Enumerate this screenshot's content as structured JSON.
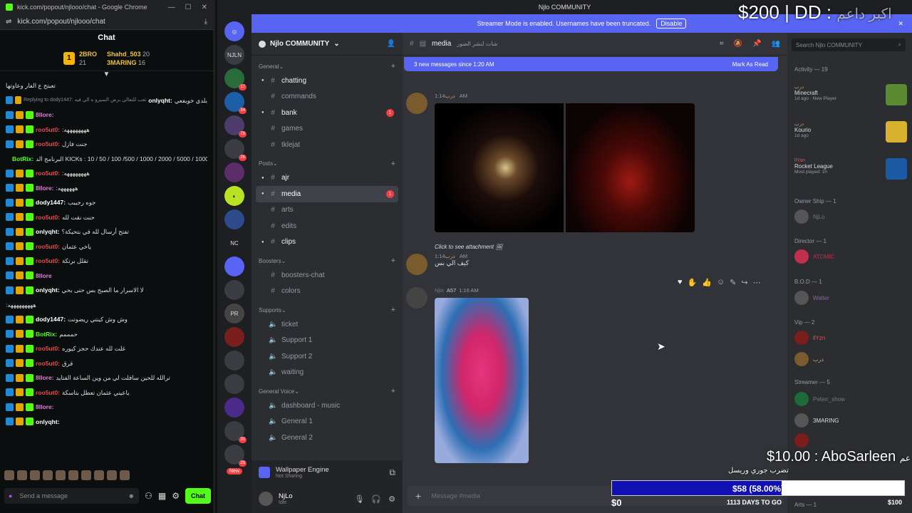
{
  "browser": {
    "title": "kick.com/popout/njlooo/chat - Google Chrome",
    "url": "kick.com/popout/njlooo/chat"
  },
  "kick_chat": {
    "header": "Chat",
    "gifters": [
      {
        "rank": "1",
        "name1": "2BRO",
        "count1": "21",
        "name2": "Shahd_503",
        "count2": "20"
      },
      {
        "name3": "3MARING",
        "count3": "16"
      }
    ],
    "messages": [
      {
        "user": "",
        "text": "تعبتح ع الفار وعاوتها",
        "color": "#ddd",
        "badges": 0
      },
      {
        "user": "",
        "reply": "Replying to dody1447: تعب للتعالي برص السيرو ه الي فيه",
        "text": "بلدي خويفعي",
        "user2": "onlyqht:",
        "color": "#ffffff",
        "badges": 2
      },
      {
        "user": "8llore:",
        "text": "",
        "color": "#e87ad9",
        "badges": 3
      },
      {
        "user": "roo5ut0:",
        "text": ":ههههههههه",
        "color": "#e84a4a",
        "badges": 3
      },
      {
        "user": "roo5ut0:",
        "text": "جنت فازل",
        "color": "#e84a4a",
        "badges": 3
      },
      {
        "user": "BotRix:",
        "text": "البرنامج الد KICKs : 10 / 50 / 100 /500 / 1000 / 2000 / 5000 / 10000 / 50000",
        "color": "#53fc18",
        "badges": 3
      },
      {
        "user": "roo5ut0:",
        "text": ":ههههههههه",
        "color": "#e84a4a",
        "badges": 3
      },
      {
        "user": "8llore:",
        "text": ":ههههههه",
        "color": "#e87ad9",
        "badges": 3
      },
      {
        "user": "dody1447:",
        "text": "جوه رجيبب",
        "color": "#ffffff",
        "badges": 3
      },
      {
        "user": "roo5ut0:",
        "text": "حنت نقت لله",
        "color": "#e84a4a",
        "badges": 3
      },
      {
        "user": "onlyqht:",
        "text": "تفتح أرسال لله في بتحيكة؟",
        "color": "#ffffff",
        "badges": 3
      },
      {
        "user": "roo5ut0:",
        "text": "ياخي عثمان",
        "color": "#e84a4a",
        "badges": 3
      },
      {
        "user": "roo5ut0:",
        "text": "تقلل برتكة",
        "color": "#e84a4a",
        "badges": 3
      },
      {
        "user": "8llore",
        "text": "",
        "color": "#e87ad9",
        "badges": 3
      },
      {
        "user": "onlyqht:",
        "text": "لا الاسرار ما الصبح بس حتى بحي",
        "color": "#ffffff",
        "badges": 3
      },
      {
        "user": "",
        "text": ":هههههههههه",
        "color": "#ddd",
        "badges": 0
      },
      {
        "user": "dody1447:",
        "text": "وش وش كينتي ريضوتت",
        "color": "#ffffff",
        "badges": 3
      },
      {
        "user": "BotRix:",
        "text": "حمممم",
        "color": "#53fc18",
        "badges": 3
      },
      {
        "user": "roo5ut0:",
        "text": "غلت لله عندك حجز كيوره",
        "color": "#e84a4a",
        "badges": 3
      },
      {
        "user": "roo5ut0:",
        "text": "فرق",
        "color": "#e84a4a",
        "badges": 3
      },
      {
        "user": "8llore:",
        "text": "ترالله للحين سافلت لي من وين الساعة الفتايد",
        "color": "#e87ad9",
        "badges": 3
      },
      {
        "user": "roo5ut0:",
        "text": "ياعيني عثمان تعطل بتاسكة",
        "color": "#e84a4a",
        "badges": 3
      },
      {
        "user": "8llore:",
        "text": "",
        "color": "#e87ad9",
        "badges": 3
      },
      {
        "user": "onlyqht:",
        "text": "",
        "color": "#ffffff",
        "badges": 3
      }
    ],
    "input_placeholder": "Send a message",
    "chat_button": "Chat"
  },
  "discord": {
    "window_title": "Njlo COMMUNITY",
    "streamer_bar": {
      "text": "Streamer Mode is enabled. Usernames have been truncated.",
      "button": "Disable"
    },
    "rail": [
      "NJLN",
      "17",
      "34",
      "78",
      "26",
      "NC",
      "PR",
      "30",
      "29",
      "New"
    ],
    "server_name": "Njlo COMMUNITY",
    "categories": [
      {
        "name": "General",
        "channels": [
          {
            "name": "chatting",
            "unread": true
          },
          {
            "name": "commands",
            "unread": false
          },
          {
            "name": "bank",
            "unread": true,
            "count": "1"
          },
          {
            "name": "games",
            "unread": false
          },
          {
            "name": "tklejat",
            "unread": false
          }
        ]
      },
      {
        "name": "Posts",
        "channels": [
          {
            "name": "ajr",
            "unread": true
          },
          {
            "name": "media",
            "unread": true,
            "count": "1",
            "active": true
          },
          {
            "name": "arts",
            "unread": false
          },
          {
            "name": "edits",
            "unread": false
          },
          {
            "name": "clips",
            "unread": true
          }
        ]
      },
      {
        "name": "Boosters",
        "channels": [
          {
            "name": "boosters-chat",
            "unread": false
          },
          {
            "name": "colors",
            "unread": false
          }
        ]
      },
      {
        "name": "Supports",
        "channels": [
          {
            "name": "ticket",
            "unread": false
          },
          {
            "name": "Support 1",
            "unread": false
          },
          {
            "name": "Support 2",
            "unread": false
          },
          {
            "name": "waiting",
            "unread": false
          }
        ]
      },
      {
        "name": "General Voice",
        "channels": [
          {
            "name": "dashboard - music",
            "unread": false
          },
          {
            "name": "General 1",
            "unread": false
          },
          {
            "name": "General 2",
            "unread": false
          }
        ]
      }
    ],
    "wallpaper": {
      "title": "Wallpaper Engine",
      "status": "Not Sharing"
    },
    "user": {
      "name": "NjLo",
      "status": "Idle"
    },
    "channel_header": {
      "name": "media",
      "topic": "شات لنشر الصور"
    },
    "new_messages": {
      "text": "3 new messages since 1:20 AM",
      "action": "Mark As Read"
    },
    "posts": [
      {
        "author": "درب",
        "time": "1:14 AM"
      },
      {
        "author": "درب",
        "attach": "Click to see attachment",
        "time": "1:14 AM",
        "text": "كيف الي بس"
      },
      {
        "author": "Njlo",
        "badge": "A57",
        "time": "1:16 AM"
      }
    ],
    "composer_placeholder": "Message #media",
    "search_placeholder": "Search Njlo COMMUNITY",
    "activity": {
      "header": "Activity — 19",
      "items": [
        {
          "user": "درب",
          "game": "Minecraft",
          "sub": "1d ago · New Player"
        },
        {
          "user": "درب",
          "game": "Kourio",
          "sub": "1d ago"
        },
        {
          "user": "llYan",
          "game": "Rocket League",
          "sub": "Most played: 1h"
        }
      ]
    },
    "roles": [
      {
        "name": "Owner Ship — 1",
        "members": [
          "NjLo"
        ]
      },
      {
        "name": "Director — 1",
        "members": [
          "ATOMIC"
        ]
      },
      {
        "name": "B.O.D — 1",
        "members": [
          "Walter"
        ]
      },
      {
        "name": "Vip — 2",
        "members": [
          "llYzn",
          "درب"
        ]
      },
      {
        "name": "Streamer — 5",
        "members": [
          "Peterr_show",
          "3MARING",
          "",
          ""
        ]
      },
      {
        "name": "Arts — 1",
        "members": []
      }
    ]
  },
  "overlay": {
    "top_right": "$200 | DD : ",
    "top_right_ar": "اكبر داعم",
    "donation": "$10.00 : AboSarleen",
    "donation_ar": "عم",
    "donation_sub": "تضرب جوري وريسل",
    "goal_text": "$58 (58.00%)",
    "goal_progress": 0.58,
    "goal_zero": "$0",
    "goal_days": "1113 DAYS TO GO",
    "goal_max": "$100"
  }
}
